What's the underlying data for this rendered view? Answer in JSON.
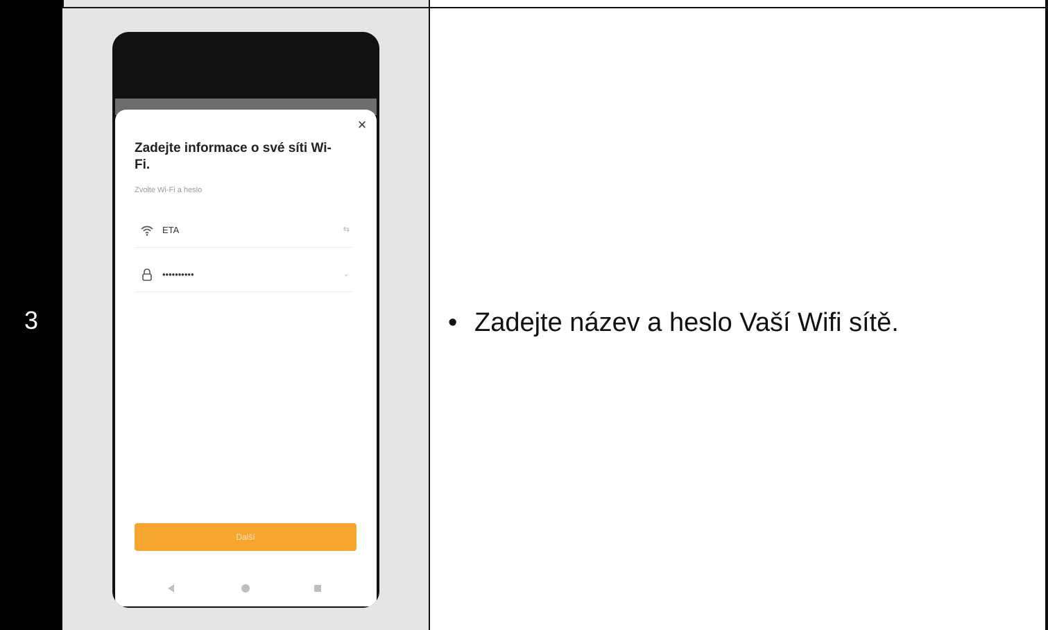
{
  "step": {
    "number": "3"
  },
  "phone": {
    "title": "Zadejte informace o své síti Wi-Fi.",
    "subtitle": "Zvolte Wi-Fi a heslo",
    "wifi_field": {
      "value": "ETA",
      "trail": "⇆",
      "icon": "wifi-icon"
    },
    "password_field": {
      "value": "••••••••••",
      "trail": "⌄",
      "icon": "lock-icon"
    },
    "close_label": "×",
    "next_label": "Další",
    "accent_color": "#f6a52e"
  },
  "instruction": {
    "bullet": "•",
    "text": "Zadejte název a heslo Vaší Wifi sítě."
  }
}
